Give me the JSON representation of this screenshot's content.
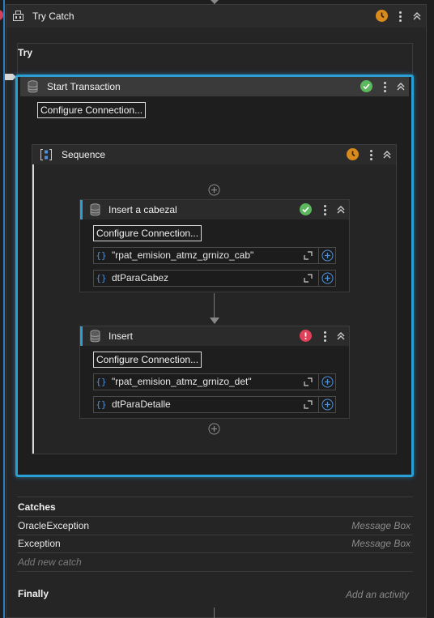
{
  "try_catch": {
    "title": "Try Catch",
    "try_label": "Try"
  },
  "start_transaction": {
    "title": "Start Transaction",
    "configure_label": "Configure Connection..."
  },
  "sequence": {
    "title": "Sequence"
  },
  "insert_cabezal": {
    "title": "Insert a cabezal",
    "configure_label": "Configure Connection...",
    "table_value": "\"rpat_emision_atmz_grnizo_cab\"",
    "datatable_value": "dtParaCabez"
  },
  "insert": {
    "title": "Insert",
    "configure_label": "Configure Connection...",
    "table_value": "\"rpat_emision_atmz_grnizo_det\"",
    "datatable_value": "dtParaDetalle"
  },
  "catches": {
    "label": "Catches",
    "items": [
      {
        "exception": "OracleException",
        "handler": "Message Box"
      },
      {
        "exception": "Exception",
        "handler": "Message Box"
      }
    ],
    "add_new": "Add new catch"
  },
  "finally": {
    "label": "Finally",
    "add_activity": "Add an activity"
  },
  "colors": {
    "accent": "#2a9fd6",
    "ok": "#5cb85c",
    "warn": "#d88a1c",
    "error": "#e0415a"
  }
}
